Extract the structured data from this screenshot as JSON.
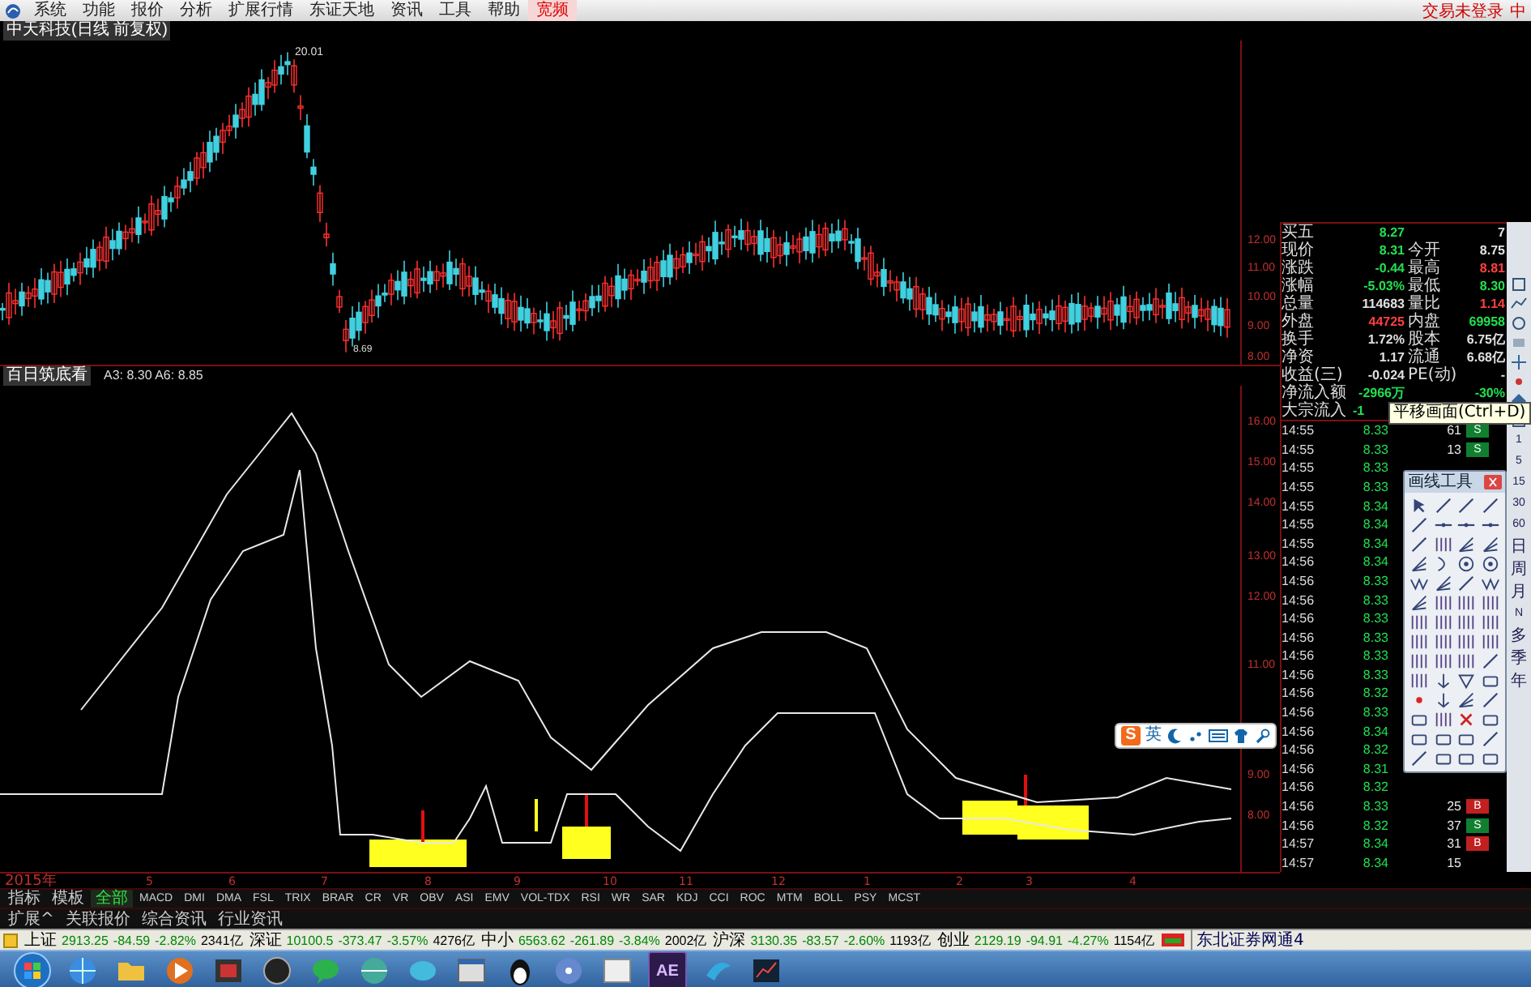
{
  "menu": {
    "items": [
      {
        "label": "系统",
        "highlight": false
      },
      {
        "label": "功能",
        "highlight": false
      },
      {
        "label": "报价",
        "highlight": false
      },
      {
        "label": "分析",
        "highlight": false
      },
      {
        "label": "扩展行情",
        "highlight": false
      },
      {
        "label": "东证天地",
        "highlight": false
      },
      {
        "label": "资讯",
        "highlight": false
      },
      {
        "label": "工具",
        "highlight": false
      },
      {
        "label": "帮助",
        "highlight": false
      },
      {
        "label": "宽频",
        "highlight": true
      }
    ],
    "login_status": "交易未登录",
    "ime_mode": "中"
  },
  "chart": {
    "title": "中天科技(日线 前复权)",
    "high_label": "20.01",
    "low_label": "8.69",
    "price_axis": [
      "12.00",
      "11.00",
      "10.00",
      "9.00",
      "8.00"
    ]
  },
  "indicator": {
    "name": "百日筑底看",
    "values": "A3: 8.30 A6: 8.85",
    "axis": [
      "16.00",
      "15.00",
      "14.00",
      "13.00",
      "12.00",
      "11.00",
      "9.00",
      "8.00"
    ]
  },
  "date_axis": [
    "2015年",
    "5",
    "6",
    "7",
    "8",
    "9",
    "10",
    "11",
    "12",
    "1",
    "2",
    "3",
    "4"
  ],
  "quote": {
    "rows": [
      {
        "left": {
          "label": "买五",
          "value": "8.27",
          "color": "#20e050"
        },
        "right": {
          "value": "7",
          "color": "#e0e0e0"
        }
      },
      {
        "left": {
          "label": "现价",
          "value": "8.31",
          "color": "#20e050"
        },
        "right": {
          "label": "今开",
          "value": "8.75",
          "color": "#e0e0e0"
        }
      },
      {
        "left": {
          "label": "涨跌",
          "value": "-0.44",
          "color": "#20e050"
        },
        "right": {
          "label": "最高",
          "value": "8.81",
          "color": "#ff4040"
        }
      },
      {
        "left": {
          "label": "涨幅",
          "value": "-5.03%",
          "color": "#20e050"
        },
        "right": {
          "label": "最低",
          "value": "8.30",
          "color": "#20e050"
        }
      },
      {
        "left": {
          "label": "总量",
          "value": "114683",
          "color": "#e0e0e0"
        },
        "right": {
          "label": "量比",
          "value": "1.14",
          "color": "#ff4040"
        }
      },
      {
        "left": {
          "label": "外盘",
          "value": "44725",
          "color": "#ff4040"
        },
        "right": {
          "label": "内盘",
          "value": "69958",
          "color": "#20e050"
        }
      },
      {
        "left": {
          "label": "换手",
          "value": "1.72%",
          "color": "#e0e0e0"
        },
        "right": {
          "label": "股本",
          "value": "6.75亿",
          "color": "#e0e0e0"
        }
      },
      {
        "left": {
          "label": "净资",
          "value": "1.17",
          "color": "#e0e0e0"
        },
        "right": {
          "label": "流通",
          "value": "6.68亿",
          "color": "#e0e0e0"
        }
      },
      {
        "left": {
          "label": "收益(三)",
          "value": "-0.024",
          "color": "#e0e0e0"
        },
        "right": {
          "label": "PE(动)",
          "value": "-",
          "color": "#e0e0e0"
        }
      },
      {
        "left": {
          "label": "净流入额",
          "value": "-2966万",
          "color": "#20e050"
        },
        "right": {
          "value": "-30%",
          "color": "#20e050"
        }
      },
      {
        "left": {
          "label": "大宗流入",
          "value": "-1",
          "color": "#20e050"
        }
      }
    ]
  },
  "ticks": [
    {
      "time": "14:55",
      "price": "8.33",
      "volume": "61",
      "side": "S",
      "kind": "sell"
    },
    {
      "time": "14:55",
      "price": "8.33",
      "volume": "13",
      "side": "S",
      "kind": "sell"
    },
    {
      "time": "14:55",
      "price": "8.33"
    },
    {
      "time": "14:55",
      "price": "8.33"
    },
    {
      "time": "14:55",
      "price": "8.34"
    },
    {
      "time": "14:55",
      "price": "8.34"
    },
    {
      "time": "14:55",
      "price": "8.34"
    },
    {
      "time": "14:56",
      "price": "8.34"
    },
    {
      "time": "14:56",
      "price": "8.33"
    },
    {
      "time": "14:56",
      "price": "8.33"
    },
    {
      "time": "14:56",
      "price": "8.33"
    },
    {
      "time": "14:56",
      "price": "8.33"
    },
    {
      "time": "14:56",
      "price": "8.33"
    },
    {
      "time": "14:56",
      "price": "8.33"
    },
    {
      "time": "14:56",
      "price": "8.32"
    },
    {
      "time": "14:56",
      "price": "8.33"
    },
    {
      "time": "14:56",
      "price": "8.34"
    },
    {
      "time": "14:56",
      "price": "8.32"
    },
    {
      "time": "14:56",
      "price": "8.31"
    },
    {
      "time": "14:56",
      "price": "8.32"
    },
    {
      "time": "14:56",
      "price": "8.33",
      "volume": "25",
      "side": "B",
      "kind": "buy"
    },
    {
      "time": "14:56",
      "price": "8.32",
      "volume": "37",
      "side": "S",
      "kind": "sell"
    },
    {
      "time": "14:57",
      "price": "8.34",
      "volume": "31",
      "side": "B",
      "kind": "buy"
    },
    {
      "time": "14:57",
      "price": "8.34",
      "volume": "15"
    }
  ],
  "tooltip": "平移画面(Ctrl+D)",
  "palette": {
    "title": "画线工具"
  },
  "ime_bar": {
    "logo": "S",
    "mode": "英"
  },
  "period_buttons": [
    "1",
    "5",
    "15",
    "30",
    "60",
    "日",
    "周",
    "月",
    "N",
    "多",
    "季",
    "年"
  ],
  "indicator_tabs": [
    {
      "label": "指标",
      "selected": false
    },
    {
      "label": "模板",
      "selected": false
    },
    {
      "label": "全部",
      "selected": true
    },
    {
      "label": "MACD",
      "selected": false
    },
    {
      "label": "DMI",
      "selected": false
    },
    {
      "label": "DMA",
      "selected": false
    },
    {
      "label": "FSL",
      "selected": false
    },
    {
      "label": "TRIX",
      "selected": false
    },
    {
      "label": "BRAR",
      "selected": false
    },
    {
      "label": "CR",
      "selected": false
    },
    {
      "label": "VR",
      "selected": false
    },
    {
      "label": "OBV",
      "selected": false
    },
    {
      "label": "ASI",
      "selected": false
    },
    {
      "label": "EMV",
      "selected": false
    },
    {
      "label": "VOL-TDX",
      "selected": false
    },
    {
      "label": "RSI",
      "selected": false
    },
    {
      "label": "WR",
      "selected": false
    },
    {
      "label": "SAR",
      "selected": false
    },
    {
      "label": "KDJ",
      "selected": false
    },
    {
      "label": "CCI",
      "selected": false
    },
    {
      "label": "ROC",
      "selected": false
    },
    {
      "label": "MTM",
      "selected": false
    },
    {
      "label": "BOLL",
      "selected": false
    },
    {
      "label": "PSY",
      "selected": false
    },
    {
      "label": "MCST",
      "selected": false
    }
  ],
  "info_tabs": [
    {
      "label": "扩展^",
      "selected": false
    },
    {
      "label": "关联报价",
      "selected": false
    },
    {
      "label": "综合资讯",
      "selected": false
    },
    {
      "label": "行业资讯",
      "selected": false
    }
  ],
  "status_bar": {
    "indices": [
      {
        "name": "上证",
        "value": "2913.25",
        "change": "-84.59",
        "pct": "-2.82%",
        "amount": "2341亿"
      },
      {
        "name": "深证",
        "value": "10100.5",
        "change": "-373.47",
        "pct": "-3.57%",
        "amount": "4276亿"
      },
      {
        "name": "中小",
        "value": "6563.62",
        "change": "-261.89",
        "pct": "-3.84%",
        "amount": "2002亿"
      },
      {
        "name": "沪深",
        "value": "3130.35",
        "change": "-83.57",
        "pct": "-2.60%",
        "amount": "1193亿"
      },
      {
        "name": "创业",
        "value": "2129.19",
        "change": "-94.91",
        "pct": "-4.27%",
        "amount": "1154亿"
      }
    ],
    "server": "东北证券网通4"
  },
  "taskbar": {
    "app_text": "AE"
  }
}
